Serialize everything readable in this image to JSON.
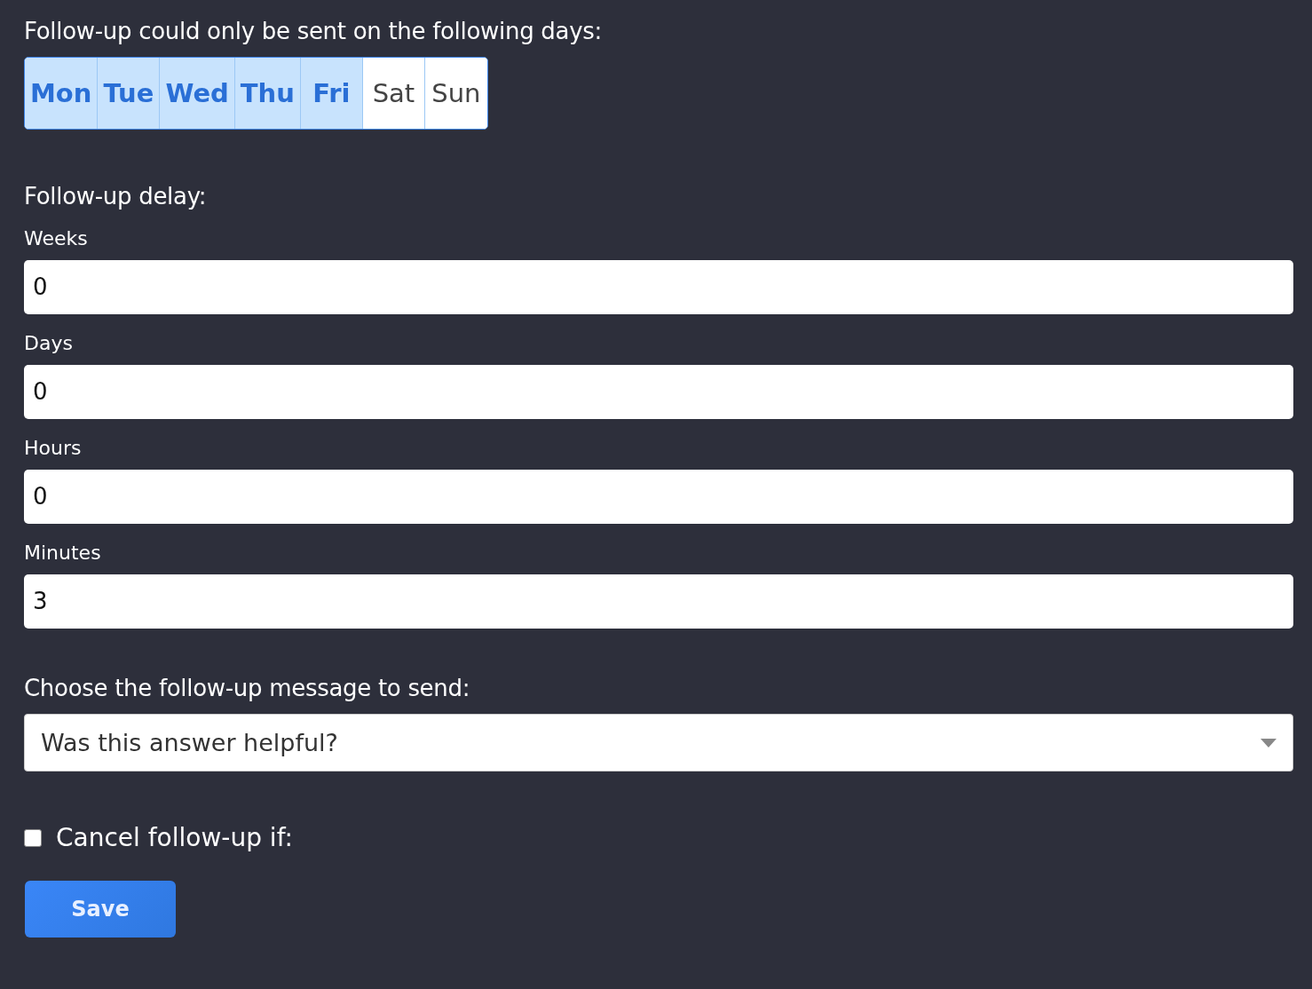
{
  "days_title": "Follow-up could only be sent on the following days:",
  "days": [
    {
      "label": "Mon",
      "selected": true
    },
    {
      "label": "Tue",
      "selected": true
    },
    {
      "label": "Wed",
      "selected": true
    },
    {
      "label": "Thu",
      "selected": true
    },
    {
      "label": "Fri",
      "selected": true
    },
    {
      "label": "Sat",
      "selected": false
    },
    {
      "label": "Sun",
      "selected": false
    }
  ],
  "delay_title": "Follow-up delay:",
  "delay_fields": [
    {
      "label": "Weeks",
      "value": "0"
    },
    {
      "label": "Days",
      "value": "0"
    },
    {
      "label": "Hours",
      "value": "0"
    },
    {
      "label": "Minutes",
      "value": "3"
    }
  ],
  "message_title": "Choose the follow-up message to send:",
  "message_select": {
    "value": "Was this answer helpful?"
  },
  "cancel": {
    "label": "Cancel follow-up if:",
    "checked": false
  },
  "save_button": "Save"
}
